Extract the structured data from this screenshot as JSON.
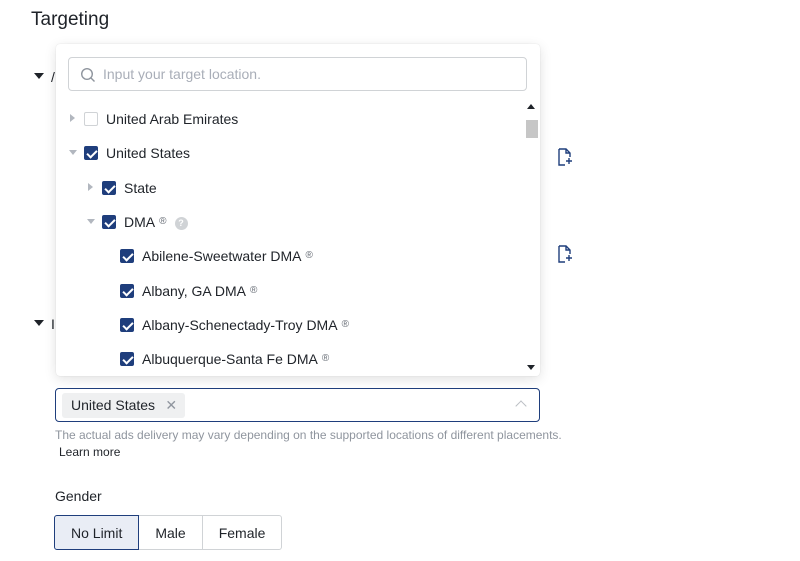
{
  "page": {
    "title": "Targeting"
  },
  "background_sections": [
    {
      "peek_text": "/"
    },
    {
      "peek_text": "I"
    }
  ],
  "location_dropdown": {
    "search": {
      "placeholder": "Input your target location."
    },
    "tree": [
      {
        "label": "United Arab Emirates",
        "level": 0,
        "expand": "collapsed",
        "checked": false,
        "reg": "",
        "help": false
      },
      {
        "label": "United States",
        "level": 0,
        "expand": "expanded",
        "checked": true,
        "reg": "",
        "help": false
      },
      {
        "label": "State",
        "level": 1,
        "expand": "collapsed",
        "checked": true,
        "reg": "",
        "help": false
      },
      {
        "label": "DMA",
        "level": 1,
        "expand": "expanded",
        "checked": true,
        "reg": "®",
        "help": true
      },
      {
        "label": "Abilene-Sweetwater DMA",
        "level": 2,
        "expand": "none",
        "checked": true,
        "reg": "®",
        "help": false
      },
      {
        "label": "Albany, GA DMA",
        "level": 2,
        "expand": "none",
        "checked": true,
        "reg": "®",
        "help": false
      },
      {
        "label": "Albany-Schenectady-Troy DMA",
        "level": 2,
        "expand": "none",
        "checked": true,
        "reg": "®",
        "help": false
      },
      {
        "label": "Albuquerque-Santa Fe DMA",
        "level": 2,
        "expand": "none",
        "checked": true,
        "reg": "®",
        "help": false
      }
    ],
    "help_glyph": "?"
  },
  "selected_locations": {
    "tags": [
      {
        "label": "United States",
        "close_glyph": "✕"
      }
    ]
  },
  "delivery_hint": "The actual ads delivery may vary depending on the supported locations of different placements.",
  "learn_more": "Learn more",
  "gender": {
    "label": "Gender",
    "options": [
      "No Limit",
      "Male",
      "Female"
    ],
    "selected": "No Limit"
  },
  "colors": {
    "accent": "#1f3e7c",
    "text": "#1f2329",
    "muted": "#8f959e",
    "border": "#d0d3d6"
  },
  "icons": {
    "section_toggle": "caret-down-icon",
    "search": "search-icon",
    "side_action": "file-add-icon",
    "tag_remove": "close-icon",
    "select_toggle": "chevron-up-icon",
    "scroll_up": "scroll-up-arrow-icon",
    "scroll_down": "scroll-down-arrow-icon"
  }
}
